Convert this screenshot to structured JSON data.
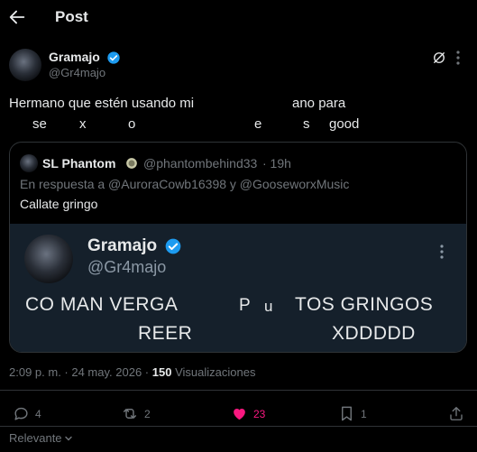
{
  "header": {
    "title": "Post"
  },
  "post": {
    "author_name": "Gramajo",
    "author_handle": "@Gr4majo",
    "text_line1_a": "Hermano que estén usando mi",
    "text_line1_b": "ano para",
    "text_line2": [
      "se",
      "x",
      "o",
      "e",
      "s",
      "good"
    ]
  },
  "quote": {
    "author_name": "SL Phantom",
    "author_handle": "@phantombehind33",
    "time": "· 19h",
    "reply_to": "En respuesta a @AuroraCowb16398 y @GooseworxMusic",
    "text": "Callate gringo",
    "inner": {
      "author_name": "Gramajo",
      "author_handle": "@Gr4majo",
      "line1_a": "CO MAN VERGA",
      "line1_p": "P",
      "line1_u": "u",
      "line1_b": "TOS GRINGOS",
      "line2_a": "REER",
      "line2_b": "XDDDDD"
    }
  },
  "meta": {
    "time": "2:09 p. m. · 24 may. 2026 ·",
    "views_count": "150",
    "views_label": "Visualizaciones"
  },
  "actions": {
    "replies": "4",
    "reposts": "2",
    "likes": "23",
    "bookmarks": "1"
  },
  "sort": {
    "label": "Relevante"
  },
  "colors": {
    "accent": "#1d9bf0",
    "like": "#f91880",
    "muted": "#71767b",
    "inner_bg": "#15202b"
  }
}
